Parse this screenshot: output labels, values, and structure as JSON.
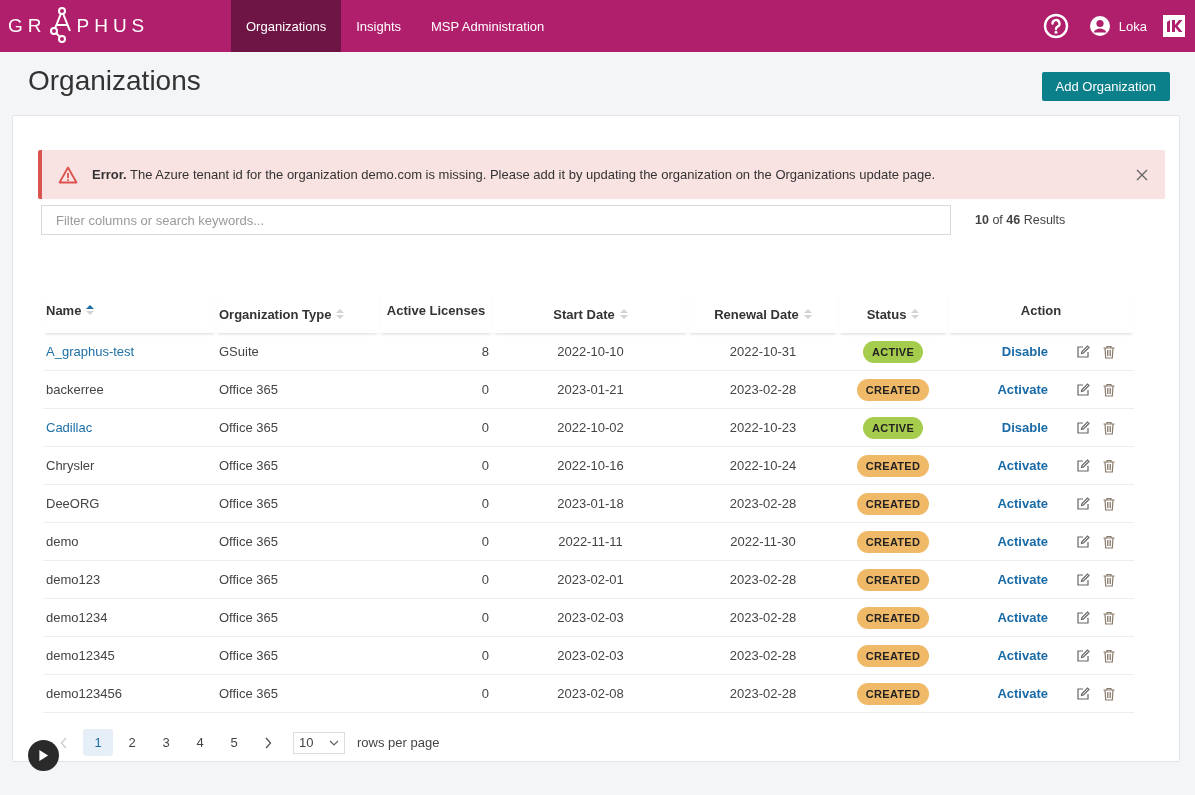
{
  "header": {
    "logo": {
      "text_start": "GR",
      "text_end": "PHUS"
    },
    "nav": [
      {
        "label": "Organizations",
        "selected": true
      },
      {
        "label": "Insights",
        "selected": false
      },
      {
        "label": "MSP Administration",
        "selected": false
      }
    ],
    "user": "Loka"
  },
  "page_title": "Organizations",
  "add_button": "Add Organization",
  "alert": {
    "kind": "error",
    "title": "Error.",
    "message": "The Azure tenant id for the organization demo.com is missing. Please add it by updating the organization on the Organizations update page."
  },
  "search": {
    "placeholder": "Filter columns or search keywords..."
  },
  "results": "**10** of **46** Results",
  "table": {
    "columns": [
      {
        "label": "Name",
        "sortable": true,
        "sorted": true
      },
      {
        "label": "Organization Type",
        "sortable": true,
        "sorted": false
      },
      {
        "label": "Active Licenses",
        "sortable": false,
        "sorted": false
      },
      {
        "label": "Start Date",
        "sortable": true,
        "sorted": false
      },
      {
        "label": "Renewal Date",
        "sortable": true,
        "sorted": false
      },
      {
        "label": "Status",
        "sortable": true,
        "sorted": false
      },
      {
        "label": "Action",
        "sortable": false,
        "sorted": false
      }
    ],
    "rows": [
      {
        "name": "A_graphus-test",
        "linked": true,
        "type": "GSuite",
        "licenses": "8",
        "start": "2022-10-10",
        "renewal": "2022-10-31",
        "status": {
          "kind": "active",
          "label": "ACTIVE"
        },
        "action": "Disable"
      },
      {
        "name": "backerree",
        "linked": false,
        "type": "Office 365",
        "licenses": "0",
        "start": "2023-01-21",
        "renewal": "2023-02-28",
        "status": {
          "kind": "created",
          "label": "CREATED"
        },
        "action": "Activate"
      },
      {
        "name": "Cadillac",
        "linked": true,
        "type": "Office 365",
        "licenses": "0",
        "start": "2022-10-02",
        "renewal": "2022-10-23",
        "status": {
          "kind": "active",
          "label": "ACTIVE"
        },
        "action": "Disable"
      },
      {
        "name": "Chrysler",
        "linked": false,
        "type": "Office 365",
        "licenses": "0",
        "start": "2022-10-16",
        "renewal": "2022-10-24",
        "status": {
          "kind": "created",
          "label": "CREATED"
        },
        "action": "Activate"
      },
      {
        "name": "DeeORG",
        "linked": false,
        "type": "Office 365",
        "licenses": "0",
        "start": "2023-01-18",
        "renewal": "2023-02-28",
        "status": {
          "kind": "created",
          "label": "CREATED"
        },
        "action": "Activate"
      },
      {
        "name": "demo",
        "linked": false,
        "type": "Office 365",
        "licenses": "0",
        "start": "2022-11-11",
        "renewal": "2022-11-30",
        "status": {
          "kind": "created",
          "label": "CREATED"
        },
        "action": "Activate"
      },
      {
        "name": "demo123",
        "linked": false,
        "type": "Office 365",
        "licenses": "0",
        "start": "2023-02-01",
        "renewal": "2023-02-28",
        "status": {
          "kind": "created",
          "label": "CREATED"
        },
        "action": "Activate"
      },
      {
        "name": "demo1234",
        "linked": false,
        "type": "Office 365",
        "licenses": "0",
        "start": "2023-02-03",
        "renewal": "2023-02-28",
        "status": {
          "kind": "created",
          "label": "CREATED"
        },
        "action": "Activate"
      },
      {
        "name": "demo12345",
        "linked": false,
        "type": "Office 365",
        "licenses": "0",
        "start": "2023-02-03",
        "renewal": "2023-02-28",
        "status": {
          "kind": "created",
          "label": "CREATED"
        },
        "action": "Activate"
      },
      {
        "name": "demo123456",
        "linked": false,
        "type": "Office 365",
        "licenses": "0",
        "start": "2023-02-08",
        "renewal": "2023-02-28",
        "status": {
          "kind": "created",
          "label": "CREATED"
        },
        "action": "Activate"
      }
    ]
  },
  "pagination": {
    "prev_disabled": true,
    "pages": [
      {
        "label": "1",
        "selected": true
      },
      {
        "label": "2",
        "selected": false
      },
      {
        "label": "3",
        "selected": false
      },
      {
        "label": "4",
        "selected": false
      },
      {
        "label": "5",
        "selected": false
      }
    ],
    "rows_per_page": "10",
    "rows_label": "rows per page"
  }
}
